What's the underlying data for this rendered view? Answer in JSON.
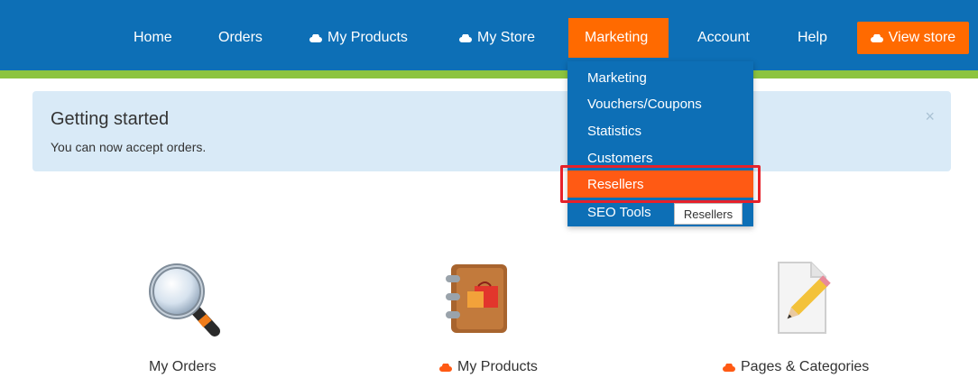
{
  "nav": {
    "items": [
      {
        "label": "Home",
        "icon": ""
      },
      {
        "label": "Orders",
        "icon": ""
      },
      {
        "label": "My Products",
        "icon": "cloud-icon"
      },
      {
        "label": "My Store",
        "icon": "cloud-icon"
      },
      {
        "label": "Marketing",
        "icon": "",
        "active": true
      },
      {
        "label": "Account",
        "icon": ""
      },
      {
        "label": "Help",
        "icon": ""
      }
    ],
    "view_store": "View store"
  },
  "alert": {
    "title": "Getting started",
    "text": "You can now accept orders.",
    "close": "×"
  },
  "dropdown": {
    "items": [
      "Marketing",
      "Vouchers/Coupons",
      "Statistics",
      "Customers",
      "Resellers",
      "SEO Tools"
    ],
    "selected": "Resellers",
    "tooltip": "Resellers"
  },
  "features": [
    {
      "label": "My Orders",
      "icon": "magnifier-icon",
      "cloud": false
    },
    {
      "label": "My Products",
      "icon": "notebook-icon",
      "cloud": true
    },
    {
      "label": "Pages & Categories",
      "icon": "page-edit-icon",
      "cloud": true
    }
  ],
  "colors": {
    "nav_bg": "#0d6fb6",
    "accent": "#ff6a00",
    "green_bar": "#8cc43f",
    "alert_bg": "#d9eaf7",
    "highlight": "#e6212a"
  }
}
